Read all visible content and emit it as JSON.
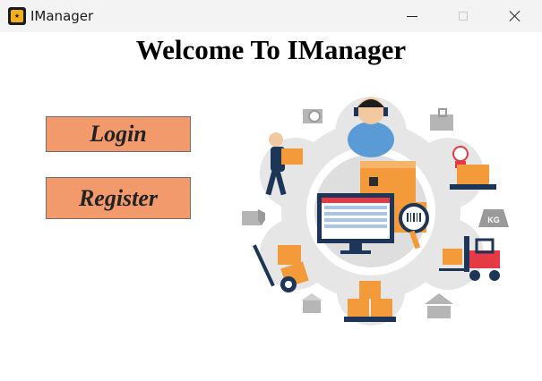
{
  "window": {
    "title": "IManager",
    "icon": "app-logo-icon",
    "controls": [
      "minimize-icon",
      "maximize-icon",
      "close-icon"
    ]
  },
  "main": {
    "heading": "Welcome To IManager",
    "login_label": "Login",
    "register_label": "Register"
  },
  "illustration": {
    "label_kg": "KG"
  },
  "colors": {
    "button_fill": "#f29a6b",
    "accent_orange": "#f39a3b",
    "illustration_gray": "#e6e6e6",
    "navy": "#1d3557"
  }
}
